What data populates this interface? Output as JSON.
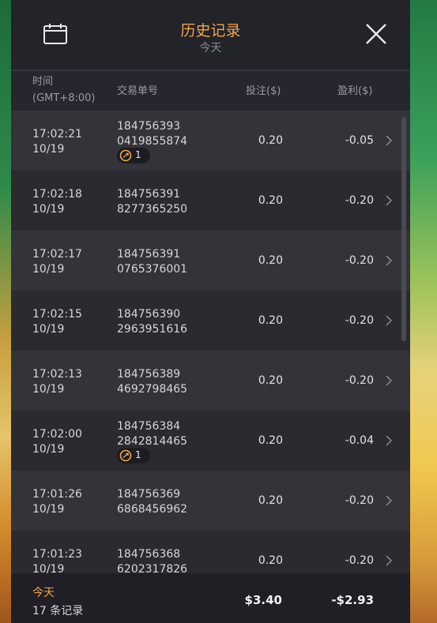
{
  "header": {
    "title": "历史记录",
    "subtitle": "今天",
    "calendar_icon": "calendar-icon",
    "close_icon": "close-icon",
    "accent_color": "#f0a646"
  },
  "columns": {
    "time": "时间",
    "timezone": "(GMT+8:00)",
    "order_id": "交易单号",
    "bet": "投注($)",
    "profit": "盈利($)"
  },
  "records": [
    {
      "time": "17:02:21",
      "date": "10/19",
      "id_line1": "184756393",
      "id_line2": "0419855874",
      "badge": "1",
      "bet": "0.20",
      "profit": "-0.05"
    },
    {
      "time": "17:02:18",
      "date": "10/19",
      "id_line1": "184756391",
      "id_line2": "8277365250",
      "badge": null,
      "bet": "0.20",
      "profit": "-0.20"
    },
    {
      "time": "17:02:17",
      "date": "10/19",
      "id_line1": "184756391",
      "id_line2": "0765376001",
      "badge": null,
      "bet": "0.20",
      "profit": "-0.20"
    },
    {
      "time": "17:02:15",
      "date": "10/19",
      "id_line1": "184756390",
      "id_line2": "2963951616",
      "badge": null,
      "bet": "0.20",
      "profit": "-0.20"
    },
    {
      "time": "17:02:13",
      "date": "10/19",
      "id_line1": "184756389",
      "id_line2": "4692798465",
      "badge": null,
      "bet": "0.20",
      "profit": "-0.20"
    },
    {
      "time": "17:02:00",
      "date": "10/19",
      "id_line1": "184756384",
      "id_line2": "2842814465",
      "badge": "1",
      "bet": "0.20",
      "profit": "-0.04"
    },
    {
      "time": "17:01:26",
      "date": "10/19",
      "id_line1": "184756369",
      "id_line2": "6868456962",
      "badge": null,
      "bet": "0.20",
      "profit": "-0.20"
    },
    {
      "time": "17:01:23",
      "date": "10/19",
      "id_line1": "184756368",
      "id_line2": "6202317826",
      "badge": null,
      "bet": "0.20",
      "profit": "-0.20"
    }
  ],
  "footer": {
    "label": "今天",
    "count": "17 条记录",
    "total_bet": "$3.40",
    "total_profit": "-$2.93"
  }
}
